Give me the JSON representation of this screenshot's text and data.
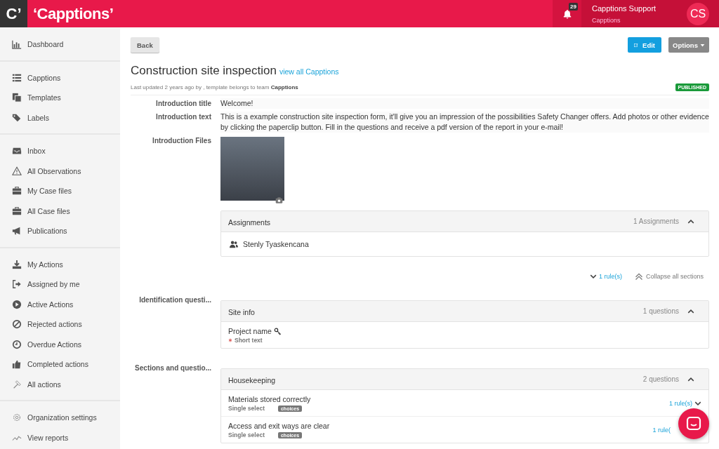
{
  "header": {
    "logo_mark": "C’",
    "logo": "‘Capptions’",
    "notifications": "29",
    "user_name": "Capptions Support",
    "user_org": "Capptions",
    "avatar": "CS"
  },
  "sidebar": {
    "groups": [
      {
        "items": [
          {
            "label": "Dashboard"
          }
        ]
      },
      {
        "items": [
          {
            "label": "Capptions"
          },
          {
            "label": "Templates"
          },
          {
            "label": "Labels"
          }
        ]
      },
      {
        "items": [
          {
            "label": "Inbox"
          },
          {
            "label": "All Observations"
          },
          {
            "label": "My Case files"
          },
          {
            "label": "All Case files"
          },
          {
            "label": "Publications"
          }
        ]
      },
      {
        "items": [
          {
            "label": "My Actions"
          },
          {
            "label": "Assigned by me"
          },
          {
            "label": "Active Actions"
          },
          {
            "label": "Rejected actions"
          },
          {
            "label": "Overdue Actions"
          },
          {
            "label": "Completed actions"
          },
          {
            "label": "All actions"
          }
        ]
      },
      {
        "items": [
          {
            "label": "Organization settings"
          },
          {
            "label": "View reports"
          }
        ]
      }
    ]
  },
  "toolbar": {
    "back": "Back",
    "edit": "Edit",
    "options": "Options"
  },
  "page": {
    "title": "Construction site inspection",
    "title_link": "view all Capptions",
    "meta": "Last updated 2 years ago by , template belongs to team **Capptions**",
    "status": "PUBLISHED"
  },
  "fields": [
    {
      "kind": "text",
      "label": "Introduction title",
      "value": "Welcome!"
    },
    {
      "kind": "text",
      "label": "Introduction text",
      "value": "This is a example construction site inspection form, it'll give you an impression of the possibilities Safety Changer offers. Add photos or other evidence by clicking the paperclip button. Fill in the questions and receive a pdf version of the report in your e-mail!"
    },
    {
      "kind": "files",
      "label": "Introduction Files"
    }
  ],
  "assignments": {
    "title": "Assignments",
    "count": "1 Assignments",
    "expanded": true,
    "people": [
      "Stenly Tyaskencana"
    ]
  },
  "rules_link": "1 rule(s)",
  "collapse_all": "Collapse all sections",
  "groups": [
    {
      "label": "Identification questi...",
      "title": "Site info",
      "count": "1 questions",
      "expanded": true,
      "questions": [
        {
          "name": "Project name",
          "key_question": true,
          "required": true,
          "type": "Short text"
        }
      ]
    },
    {
      "label": "Sections and questio...",
      "title": "Housekeeping",
      "count": "2 questions",
      "expanded": true,
      "questions": [
        {
          "name": "Materials stored correctly",
          "key_question": false,
          "required": false,
          "type": "Single select",
          "tag": "choices",
          "rules": "1 rule(s)"
        },
        {
          "name": "Access and exit ways are clear",
          "key_question": false,
          "required": false,
          "type": "Single select",
          "tag": "choices",
          "rules": "1 rule("
        }
      ]
    }
  ]
}
